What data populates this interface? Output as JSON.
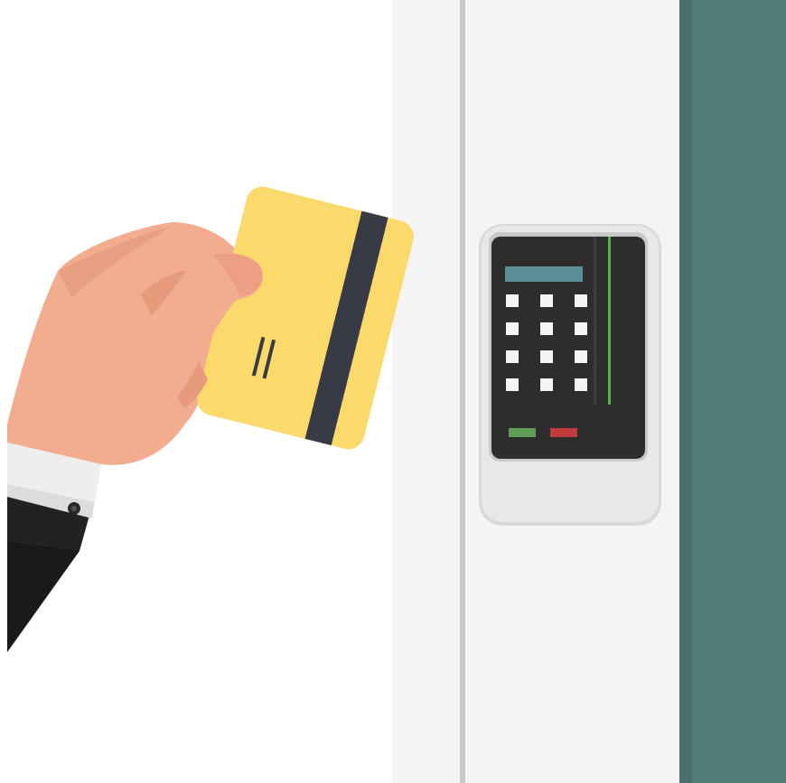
{
  "scene": {
    "description_colors": {
      "background": "#ffffff",
      "wall": "#f4f4f4",
      "door": "#527b79",
      "card": "#fbd96a",
      "stripe": "#383b45",
      "skin": "#f2ad8f",
      "skin_shadow": "#e69b7d",
      "cuff": "#eeeeee",
      "sleeve": "#222222",
      "reader_body": "#e8e8e8",
      "reader_face": "#2d2d2d",
      "screen": "#5a8f95",
      "key": "#f5f5f5",
      "led_green": "#5f9d59",
      "led_red": "#c23a3a",
      "slot_line": "#58b14a"
    },
    "keypad_rows": 4,
    "keypad_cols": 3,
    "icons": [
      "hand-holding-card",
      "keycard",
      "card-reader",
      "door"
    ]
  }
}
